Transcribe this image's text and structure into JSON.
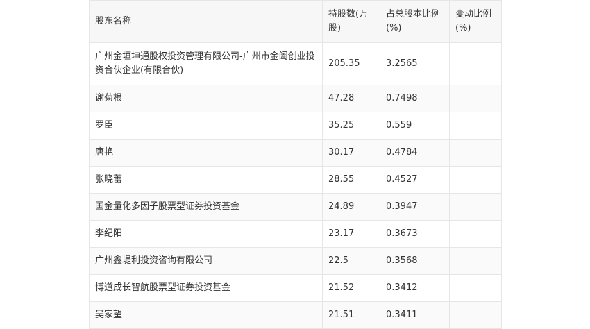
{
  "headers": [
    "股东名称",
    "持股数(万股)",
    "占总股本比例(%)",
    "变动比例(%)"
  ],
  "rows": [
    {
      "name": "广州金垣坤通股权投资管理有限公司-广州市金阖创业投资合伙企业(有限合伙)",
      "shares": "205.35",
      "ratio": "3.2565",
      "change": ""
    },
    {
      "name": "谢菊根",
      "shares": "47.28",
      "ratio": "0.7498",
      "change": ""
    },
    {
      "name": "罗臣",
      "shares": "35.25",
      "ratio": "0.559",
      "change": ""
    },
    {
      "name": "唐艳",
      "shares": "30.17",
      "ratio": "0.4784",
      "change": ""
    },
    {
      "name": "张晓蕾",
      "shares": "28.55",
      "ratio": "0.4527",
      "change": ""
    },
    {
      "name": "国金量化多因子股票型证券投资基金",
      "shares": "24.89",
      "ratio": "0.3947",
      "change": ""
    },
    {
      "name": "李纪阳",
      "shares": "23.17",
      "ratio": "0.3673",
      "change": ""
    },
    {
      "name": "广州鑫堤利投资咨询有限公司",
      "shares": "22.5",
      "ratio": "0.3568",
      "change": ""
    },
    {
      "name": "博道成长智航股票型证券投资基金",
      "shares": "21.52",
      "ratio": "0.3412",
      "change": ""
    },
    {
      "name": "吴家望",
      "shares": "21.51",
      "ratio": "0.3411",
      "change": ""
    }
  ]
}
